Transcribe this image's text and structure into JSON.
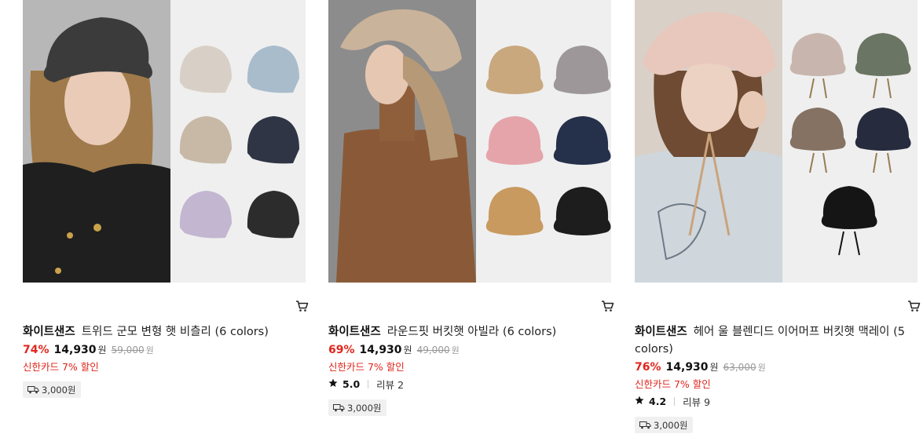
{
  "colors": {
    "accent_red": "#e1261c",
    "badge_bg": "#f0f0f0"
  },
  "products": [
    {
      "brand": "화이트샌즈",
      "name": "트위드 군모 변형 햇 비츨리 (6 colors)",
      "discount_pct": "74%",
      "price": "14,930",
      "currency": "원",
      "original_price": "59,000",
      "card_discount": "신한카드 7% 할인",
      "shipping": "3,000원",
      "rating": null,
      "reviews": null,
      "icons": [
        "cart-icon",
        "truck-icon"
      ]
    },
    {
      "brand": "화이트샌즈",
      "name": "라운드핏 버킷햇 아빌라 (6 colors)",
      "discount_pct": "69%",
      "price": "14,930",
      "currency": "원",
      "original_price": "49,000",
      "card_discount": "신한카드 7% 할인",
      "rating": "5.0",
      "reviews": "리뷰 2",
      "shipping": "3,000원",
      "icons": [
        "cart-icon",
        "star-icon",
        "truck-icon"
      ]
    },
    {
      "brand": "화이트샌즈",
      "name": "헤어 울 블렌디드 이어머프 버킷햇 맥레이 (5 colors)",
      "discount_pct": "76%",
      "price": "14,930",
      "currency": "원",
      "original_price": "63,000",
      "card_discount": "신한카드 7% 할인",
      "rating": "4.2",
      "reviews": "리뷰 9",
      "shipping": "3,000원",
      "icons": [
        "cart-icon",
        "star-icon",
        "truck-icon"
      ]
    }
  ]
}
